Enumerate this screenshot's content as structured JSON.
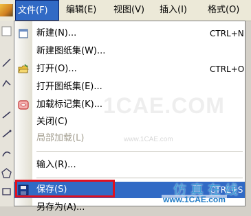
{
  "menubar": {
    "items": [
      {
        "label": "文件(F)",
        "active": true
      },
      {
        "label": "编辑(E)"
      },
      {
        "label": "视图(V)"
      },
      {
        "label": "插入(I)"
      },
      {
        "label": "格式(O)"
      }
    ]
  },
  "file_menu": {
    "items": [
      {
        "label": "新建(N)...",
        "shortcut": "CTRL+N",
        "icon": "new-file-icon"
      },
      {
        "label": "新建图纸集(W)..."
      },
      {
        "label": "打开(O)...",
        "shortcut": "CTRL+O",
        "icon": "open-folder-icon"
      },
      {
        "label": "打开图纸集(E)..."
      },
      {
        "label": "加载标记集(K)...",
        "icon": "markup-set-icon"
      },
      {
        "label": "关闭(C)"
      },
      {
        "label": "局部加载(L)",
        "disabled": true
      },
      {
        "label": "输入(R)..."
      },
      {
        "label": "保存(S)",
        "shortcut": "CTRL+S",
        "icon": "save-icon",
        "selected": true
      },
      {
        "label": "另存为(A)..."
      }
    ]
  },
  "watermark": {
    "big": "1CAE.COM",
    "small": "www.1CAE.com",
    "stamp": "仿真在线",
    "site": "www.1CAE.com"
  },
  "colors": {
    "selection": "#316ac5",
    "highlight_box": "#e01020",
    "menubar": "#ece9d8"
  }
}
